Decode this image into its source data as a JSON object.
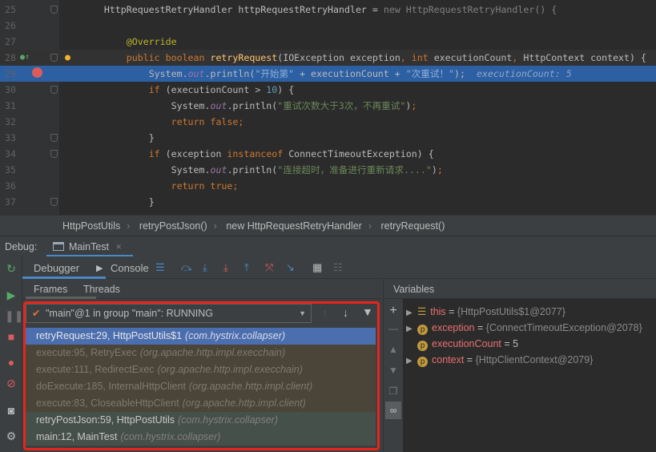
{
  "editor": {
    "lines": [
      {
        "n": "25",
        "fold": true,
        "indent": "        ",
        "tokens": [
          [
            "HttpRequestRetryHandler httpRequestRetryHandler = ",
            ""
          ],
          [
            "new ",
            "cm"
          ],
          [
            "HttpRequestRetryHandler() {",
            "cm"
          ]
        ]
      },
      {
        "n": "26",
        "indent": "",
        "tokens": []
      },
      {
        "n": "27",
        "indent": "            ",
        "tokens": [
          [
            "@Override",
            "an"
          ]
        ]
      },
      {
        "n": "28",
        "fold": true,
        "indent": "            ",
        "tokens": [
          [
            "public boolean ",
            "kw"
          ],
          [
            "retryRequest",
            "fn"
          ],
          [
            "(IOException exception",
            ""
          ],
          [
            ", ",
            "kw"
          ],
          [
            "int ",
            "kw"
          ],
          [
            "executionCount",
            ""
          ],
          [
            ", ",
            "kw"
          ],
          [
            "HttpContext context) {",
            ""
          ]
        ]
      },
      {
        "n": "29",
        "indent": "                ",
        "tokens": [
          [
            "System.",
            ""
          ],
          [
            "out",
            "fld"
          ],
          [
            ".println(",
            ""
          ],
          [
            "\"开始第\"",
            "st"
          ],
          [
            " + executionCount + ",
            ""
          ],
          [
            "\"次重试！\"",
            "st"
          ],
          [
            ");",
            ""
          ]
        ],
        "debug": "executionCount: 5"
      },
      {
        "n": "30",
        "fold": true,
        "indent": "                ",
        "tokens": [
          [
            "if ",
            "kw"
          ],
          [
            "(executionCount > ",
            ""
          ],
          [
            "10",
            "num"
          ],
          [
            ") {",
            ""
          ]
        ]
      },
      {
        "n": "31",
        "indent": "                    ",
        "tokens": [
          [
            "System.",
            ""
          ],
          [
            "out",
            "fld"
          ],
          [
            ".println(",
            ""
          ],
          [
            "\"重试次数大于3次，不再重试\"",
            "st"
          ],
          [
            ")",
            ""
          ],
          [
            ";",
            "kw"
          ]
        ]
      },
      {
        "n": "32",
        "indent": "                    ",
        "tokens": [
          [
            "return false",
            "kw"
          ],
          [
            ";",
            "kw"
          ]
        ]
      },
      {
        "n": "33",
        "fold": true,
        "indent": "                ",
        "tokens": [
          [
            "}",
            ""
          ]
        ]
      },
      {
        "n": "34",
        "fold": true,
        "indent": "                ",
        "tokens": [
          [
            "if ",
            "kw"
          ],
          [
            "(exception ",
            ""
          ],
          [
            "instanceof ",
            "kw"
          ],
          [
            "ConnectTimeoutException) {",
            ""
          ]
        ]
      },
      {
        "n": "35",
        "indent": "                    ",
        "tokens": [
          [
            "System.",
            ""
          ],
          [
            "out",
            "fld"
          ],
          [
            ".println(",
            ""
          ],
          [
            "\"连接超时，准备进行重新请求....\"",
            "st"
          ],
          [
            ")",
            ""
          ],
          [
            ";",
            "kw"
          ]
        ]
      },
      {
        "n": "36",
        "indent": "                    ",
        "tokens": [
          [
            "return true",
            "kw"
          ],
          [
            ";",
            "kw"
          ]
        ]
      },
      {
        "n": "37",
        "fold": true,
        "indent": "                ",
        "tokens": [
          [
            "}",
            ""
          ]
        ]
      }
    ]
  },
  "breadcrumb": [
    "HttpPostUtils",
    "retryPostJson()",
    "new HttpRequestRetryHandler",
    "retryRequest()"
  ],
  "debug": {
    "label": "Debug:",
    "tab": "MainTest",
    "close": "×"
  },
  "toolbar": {
    "debugger": "Debugger",
    "console": "Console"
  },
  "subtabs": {
    "frames": "Frames",
    "threads": "Threads"
  },
  "thread": {
    "check": "✔",
    "label": "\"main\"@1 in group \"main\": RUNNING"
  },
  "frames": [
    {
      "method": "retryRequest:29, HttpPostUtils$1",
      "pkg": "(com.hystrix.collapser)",
      "kind": "selected"
    },
    {
      "method": "execute:95, RetryExec",
      "pkg": "(org.apache.http.impl.execchain)",
      "kind": "lib"
    },
    {
      "method": "execute:111, RedirectExec",
      "pkg": "(org.apache.http.impl.execchain)",
      "kind": "lib"
    },
    {
      "method": "doExecute:185, InternalHttpClient",
      "pkg": "(org.apache.http.impl.client)",
      "kind": "lib"
    },
    {
      "method": "execute:83, CloseableHttpClient",
      "pkg": "(org.apache.http.impl.client)",
      "kind": "lib"
    },
    {
      "method": "retryPostJson:59, HttpPostUtils",
      "pkg": "(com.hystrix.collapser)",
      "kind": "user"
    },
    {
      "method": "main:12, MainTest",
      "pkg": "(com.hystrix.collapser)",
      "kind": "user"
    }
  ],
  "variables": {
    "title": "Variables",
    "items": [
      {
        "name": "this",
        "value": "{HttpPostUtils$1@2077}",
        "expand": true,
        "icon": "field-list-icon"
      },
      {
        "name": "exception",
        "value": "{ConnectTimeoutException@2078}",
        "expand": true,
        "icon": "p"
      },
      {
        "name": "executionCount",
        "value": "5",
        "expand": false,
        "icon": "p"
      },
      {
        "name": "context",
        "value": "{HttpClientContext@2079}",
        "expand": true,
        "icon": "p"
      }
    ]
  },
  "colors": {
    "selected": "#4b6eaf",
    "lib": "#4a4538",
    "user": "#46504a",
    "highlight": "#e8241c"
  }
}
